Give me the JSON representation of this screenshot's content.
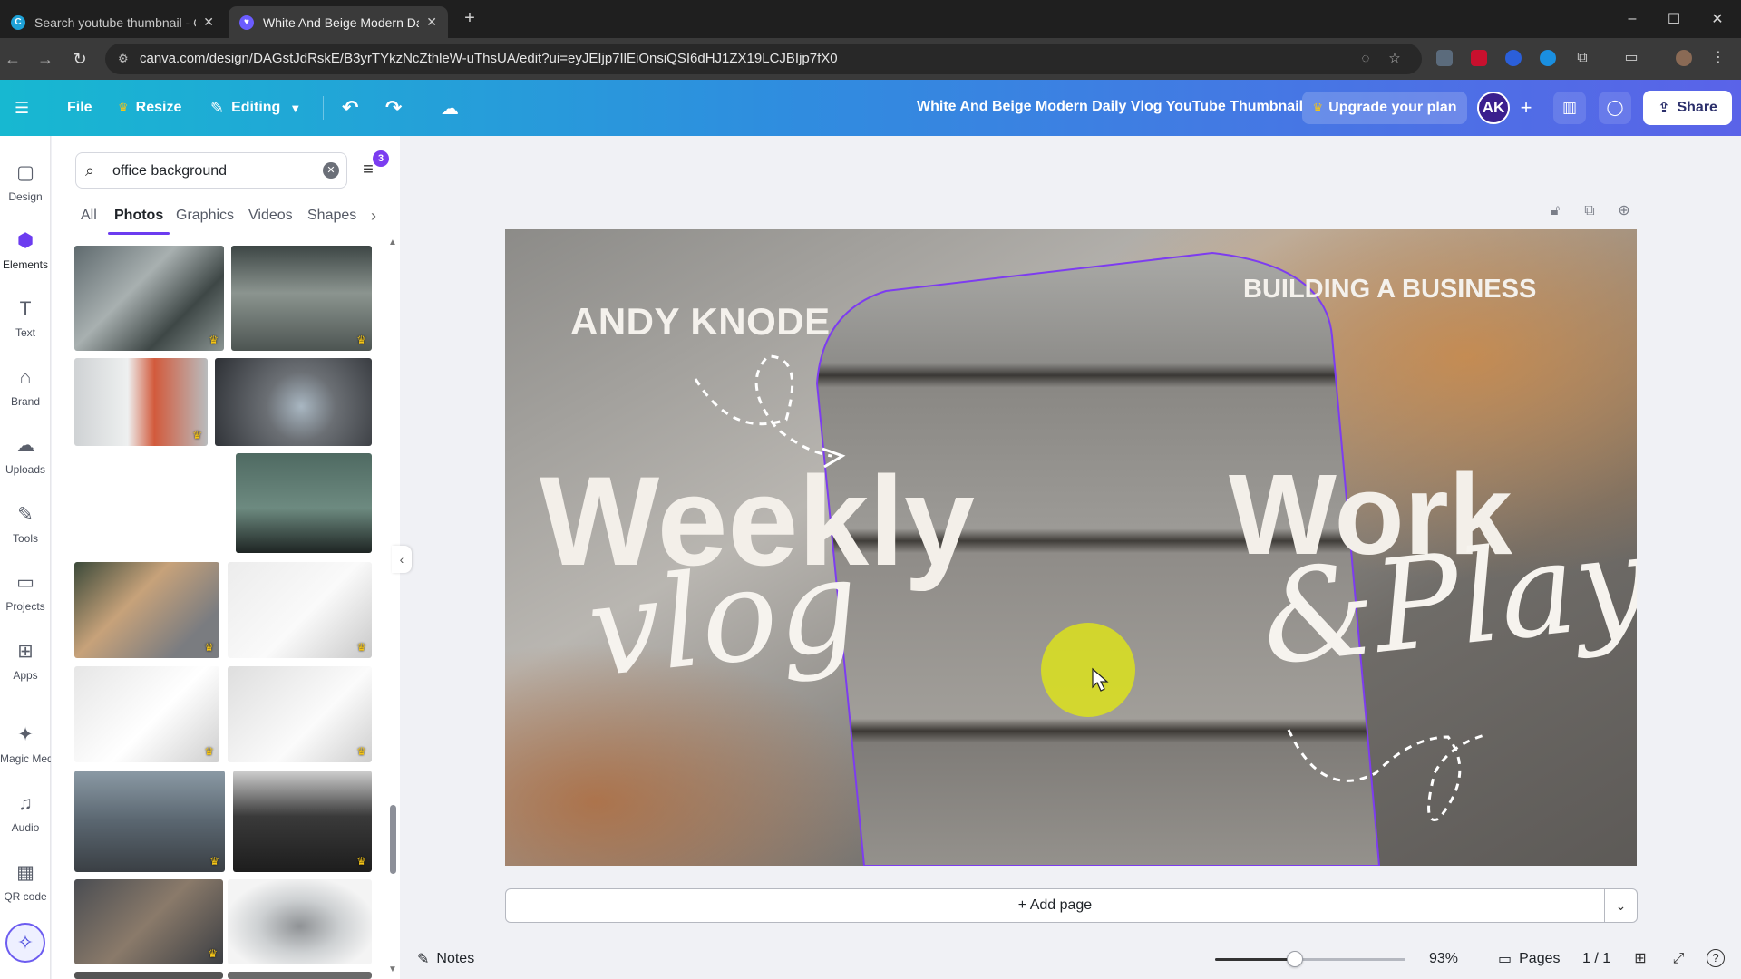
{
  "browser": {
    "tabs": [
      {
        "title": "Search youtube thumbnail - Ca",
        "active": false
      },
      {
        "title": "White And Beige Modern Daily",
        "active": true
      }
    ],
    "new_tab": "+",
    "url": "canva.com/design/DAGstJdRskE/B3yrTYkzNcZthleW-uThsUA/edit?ui=eyJEIjp7IlEiOnsiQSI6dHJ1ZX19LCJBIjp7fX0",
    "window_controls": {
      "minimize": "–",
      "maximize": "☐",
      "close": "✕"
    }
  },
  "header": {
    "menu_icon": "☰",
    "file_label": "File",
    "resize_label": "Resize",
    "editing_label": "Editing",
    "document_title": "White And Beige Modern Daily Vlog YouTube Thumbnail",
    "upgrade_label": "Upgrade your plan",
    "avatar_initials": "AK",
    "share_label": "Share"
  },
  "rail": {
    "items": [
      {
        "label": "Design",
        "icon": "▢"
      },
      {
        "label": "Elements",
        "icon": "⬢"
      },
      {
        "label": "Text",
        "icon": "T"
      },
      {
        "label": "Brand",
        "icon": "⌂"
      },
      {
        "label": "Uploads",
        "icon": "☁"
      },
      {
        "label": "Tools",
        "icon": "✎"
      },
      {
        "label": "Projects",
        "icon": "▭"
      },
      {
        "label": "Apps",
        "icon": "⊞"
      },
      {
        "label": "Magic Media",
        "icon": "✦"
      },
      {
        "label": "Audio",
        "icon": "♫"
      },
      {
        "label": "QR code",
        "icon": "▦"
      }
    ]
  },
  "panel": {
    "search_value": "office background",
    "filter_count": "3",
    "tabs": [
      "All",
      "Photos",
      "Graphics",
      "Videos",
      "Shapes"
    ],
    "active_tab": "Photos"
  },
  "canvas": {
    "texts": {
      "name": "ANDY KNODE",
      "business": "BUILDING A BUSINESS",
      "weekly": "Weekly",
      "vlog": "vlog",
      "work": "Work",
      "play": "&Play"
    }
  },
  "footer": {
    "add_page_label": "+ Add page",
    "notes_label": "Notes",
    "zoom_percent": 93,
    "zoom_label": "93%",
    "pages_label": "Pages",
    "page_count": "1 / 1"
  },
  "colors": {
    "header_start": "#17b8d1",
    "header_end": "#5a63e8",
    "accent": "#6c3cf0",
    "crown": "#f5c518"
  }
}
